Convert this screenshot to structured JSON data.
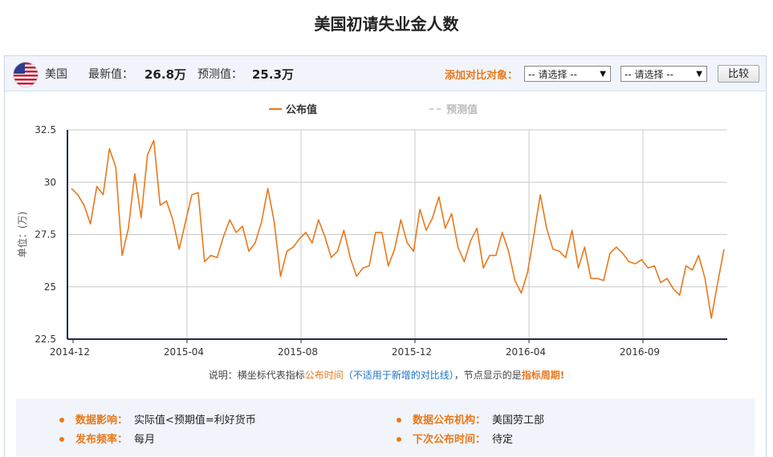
{
  "title": "美国初请失业金人数",
  "toolbar": {
    "country": "美国",
    "latest_label": "最新值：",
    "latest_value": "26.8万",
    "forecast_label": "预测值：",
    "forecast_value": "25.3万",
    "compare_label": "添加对比对象：",
    "select1": "-- 请选择 --",
    "select2": "-- 请选择 --",
    "compare_button": "比较"
  },
  "colors": {
    "series": "#e9781b",
    "forecast": "#cfcfcf",
    "accent": "#e9781b",
    "axis": "#1f2b4d"
  },
  "chart_data": {
    "type": "line",
    "ylabel": "单位：(万)",
    "ylim": [
      22.5,
      32.5
    ],
    "yticks": [
      "22.5",
      "25",
      "27.5",
      "30",
      "32.5"
    ],
    "xticks": [
      "2014-12",
      "2015-04",
      "2015-08",
      "2015-12",
      "2016-04",
      "2016-09"
    ],
    "grid": true,
    "legend": "top-center",
    "series": [
      {
        "name": "公布值",
        "values": [
          29.7,
          29.4,
          28.9,
          28.0,
          29.8,
          29.4,
          31.6,
          30.7,
          26.5,
          27.8,
          30.4,
          28.3,
          31.3,
          32.0,
          28.9,
          29.1,
          28.2,
          26.8,
          28.1,
          29.4,
          29.5,
          26.2,
          26.5,
          26.4,
          27.4,
          28.2,
          27.6,
          27.9,
          26.7,
          27.1,
          28.1,
          29.7,
          28.1,
          25.5,
          26.7,
          26.9,
          27.3,
          27.6,
          27.1,
          28.2,
          27.4,
          26.4,
          26.7,
          27.7,
          26.4,
          25.5,
          25.9,
          26.0,
          27.6,
          27.6,
          26.0,
          26.8,
          28.2,
          27.1,
          26.7,
          28.7,
          27.7,
          28.3,
          29.3,
          27.8,
          28.5,
          26.9,
          26.2,
          27.2,
          27.8,
          25.9,
          26.5,
          26.5,
          27.6,
          26.7,
          25.3,
          24.7,
          25.7,
          27.5,
          29.4,
          27.8,
          26.8,
          26.7,
          26.4,
          27.7,
          25.9,
          26.9,
          25.4,
          25.4,
          25.3,
          26.6,
          26.9,
          26.6,
          26.2,
          26.1,
          26.3,
          25.9,
          26.0,
          25.2,
          25.4,
          24.9,
          24.6,
          26.0,
          25.8,
          26.5,
          25.4,
          23.5,
          25.2,
          26.8
        ]
      },
      {
        "name": "预测值",
        "values": []
      }
    ],
    "note_parts": [
      "说明：横坐标代表指标",
      "公布时间",
      "（不适用于新增的对比线）",
      "，节点显示的是",
      "指标周期",
      "!"
    ]
  },
  "info": {
    "impact_label": "数据影响：",
    "impact_value": "实际值<预期值=利好货币",
    "agency_label": "数据公布机构：",
    "agency_value": "美国劳工部",
    "freq_label": "发布频率：",
    "freq_value": "每月",
    "next_label": "下次公布时间：",
    "next_value": "待定"
  }
}
